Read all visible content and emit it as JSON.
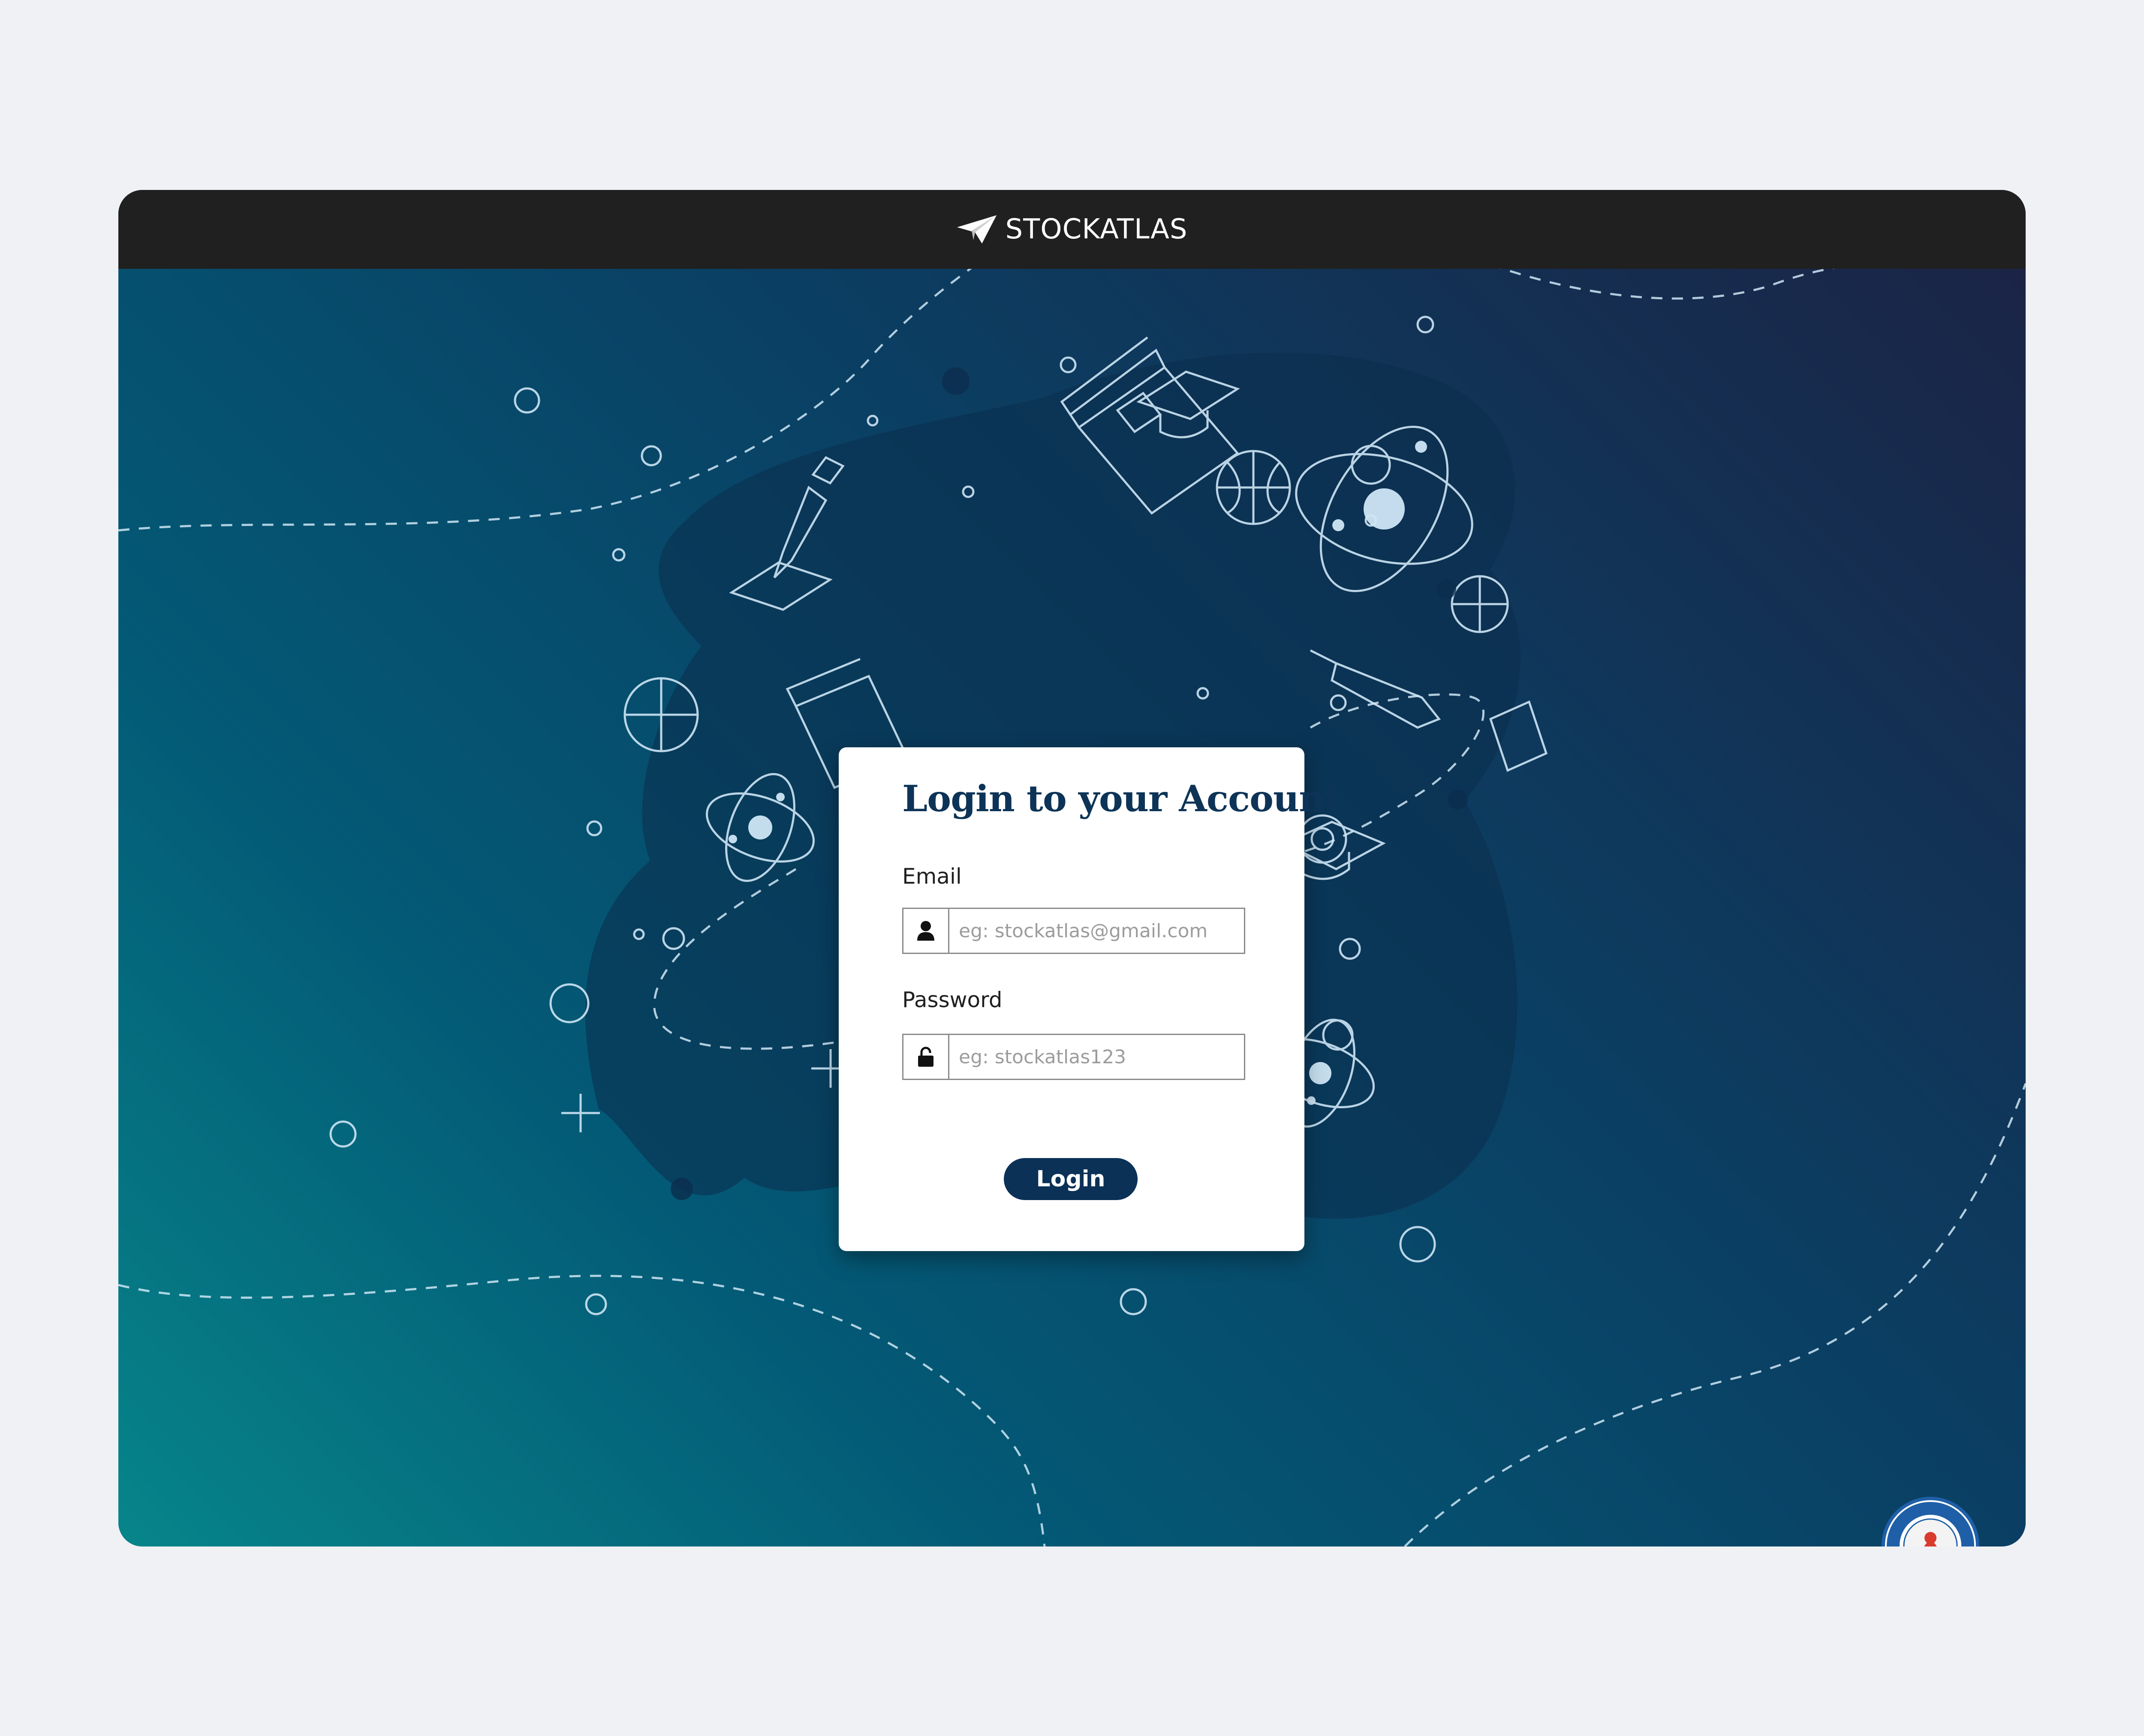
{
  "app": {
    "brand_name": "STOCKATLAS"
  },
  "login": {
    "title": "Login to your Account",
    "email_label": "Email",
    "email_placeholder": "eg: stockatlas@gmail.com",
    "password_label": "Password",
    "password_placeholder": "eg: stockatlas123",
    "login_button": "Login"
  },
  "icons": {
    "brand": "paper-plane-icon",
    "email": "user-icon",
    "password": "unlock-icon",
    "seal": "college-seal-icon"
  },
  "colors": {
    "page_bg": "#eff1f5",
    "topbar": "#202020",
    "gradient_start": "#07858a",
    "gradient_end": "#1b2446",
    "title": "#0d3457",
    "button": "#0b3157"
  }
}
